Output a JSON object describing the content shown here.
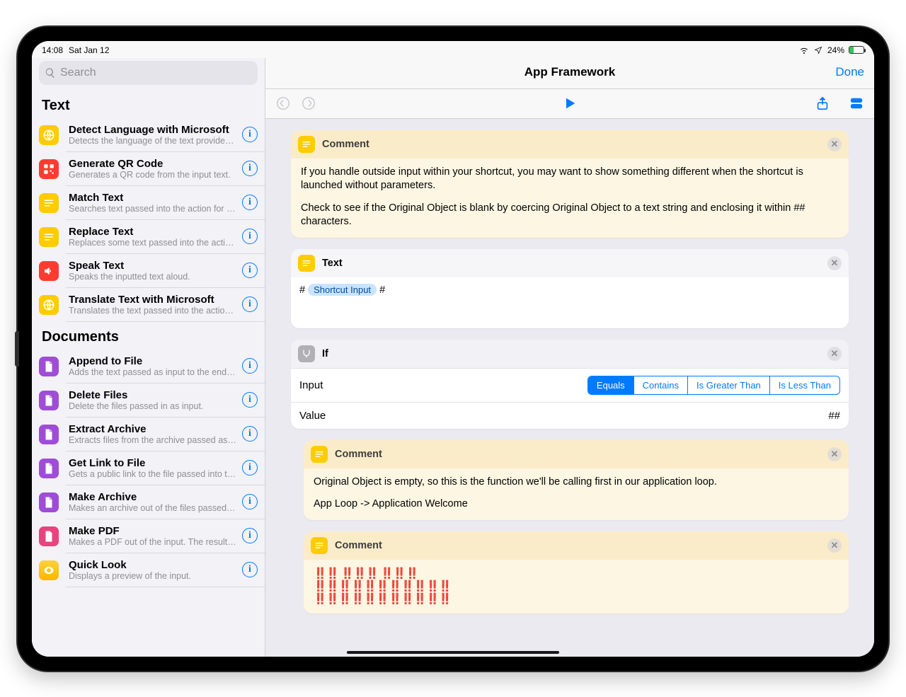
{
  "statusbar": {
    "time": "14:08",
    "date": "Sat Jan 12",
    "battery_pct": "24%"
  },
  "sidebar": {
    "search_placeholder": "Search",
    "section_text": "Text",
    "section_documents": "Documents",
    "text_items": [
      {
        "title": "Detect Language with Microsoft",
        "sub": "Detects the language of the text provided as…"
      },
      {
        "title": "Generate QR Code",
        "sub": "Generates a QR code from the input text."
      },
      {
        "title": "Match Text",
        "sub": "Searches text passed into the action for matc…"
      },
      {
        "title": "Replace Text",
        "sub": "Replaces some text passed into the action wi…"
      },
      {
        "title": "Speak Text",
        "sub": "Speaks the inputted text aloud."
      },
      {
        "title": "Translate Text with Microsoft",
        "sub": "Translates the text passed into the action int…"
      }
    ],
    "doc_items": [
      {
        "title": "Append to File",
        "sub": "Adds the text passed as input to the end of t…"
      },
      {
        "title": "Delete Files",
        "sub": "Delete the files passed in as input."
      },
      {
        "title": "Extract Archive",
        "sub": "Extracts files from the archive passed as inp…"
      },
      {
        "title": "Get Link to File",
        "sub": "Gets a public link to the file passed into the a…"
      },
      {
        "title": "Make Archive",
        "sub": "Makes an archive out of the files passed as in…"
      },
      {
        "title": "Make PDF",
        "sub": "Makes a PDF out of the input. The resulting P…"
      },
      {
        "title": "Quick Look",
        "sub": "Displays a preview of the input."
      }
    ]
  },
  "editor": {
    "title": "App Framework",
    "done": "Done",
    "comment_label": "Comment",
    "c1_p1": "If you handle outside input within your shortcut, you may want to show something different when the shortcut is launched without parameters.",
    "c1_p2": "Check to see if the Original Object is blank by coercing Original Object to a text string and enclosing it within ## characters.",
    "text_label": "Text",
    "text_prefix": "# ",
    "text_token": "Shortcut Input",
    "text_suffix": " #",
    "if_label": "If",
    "if_input_label": "Input",
    "if_value_label": "Value",
    "if_value": "##",
    "seg": [
      "Equals",
      "Contains",
      "Is Greater Than",
      "Is Less Than"
    ],
    "c2_p1": "Original Object is empty, so this is the function we'll be calling first in our application loop.",
    "c2_p2": "App Loop -> Application Welcome",
    "exc_lines": [
      "‼️‼️   ‼️‼️‼️   ‼️‼️‼️",
      "‼️‼️‼️‼️‼️‼️‼️‼️‼️‼️‼️",
      "‼️‼️‼️‼️‼️‼️‼️‼️‼️‼️‼️"
    ]
  }
}
